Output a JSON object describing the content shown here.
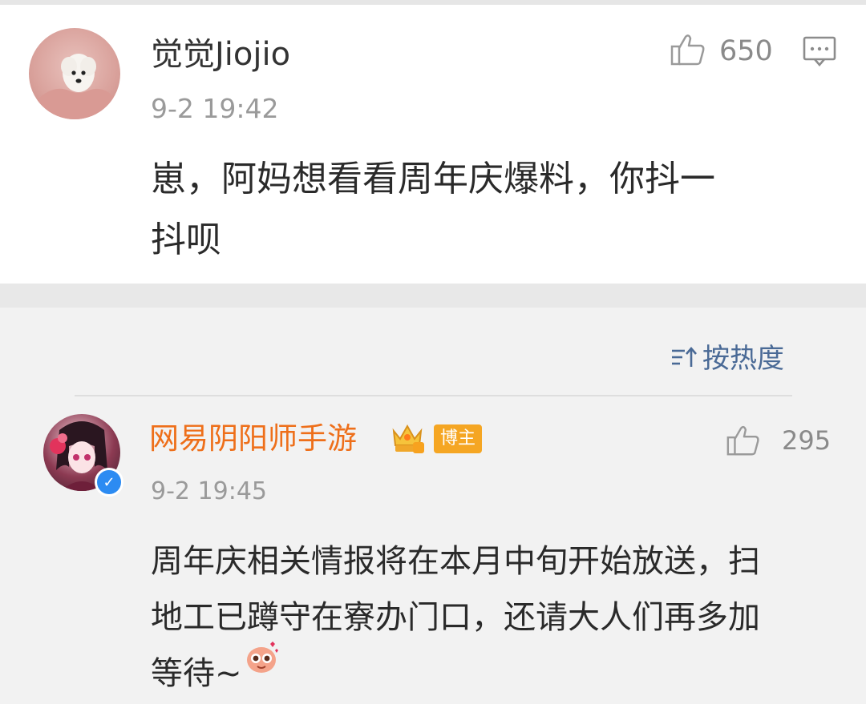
{
  "top_comment": {
    "username": "觉觉Jiojio",
    "time": "9-2 19:42",
    "likes": "650",
    "text": "崽，阿妈想看看周年庆爆料，你抖一\n抖呗"
  },
  "replies": {
    "sort_label": "按热度",
    "items": [
      {
        "username": "网易阴阳师手游",
        "badge": "博主",
        "time": "9-2 19:45",
        "likes": "295",
        "text": "周年庆相关情报将在本月中旬开始放送，扫\n地工已蹲守在寮办门口，还请大人们再多加\n等待~"
      }
    ]
  },
  "colors": {
    "username_default": "#333333",
    "username_official": "#ee6f1a",
    "sort_accent": "#4a6a96",
    "host_badge": "#f5a623",
    "verified": "#2c8bf2"
  },
  "icons": [
    "thumbs-up-icon",
    "comment-icon",
    "sort-icon",
    "crown-icon",
    "verified-icon",
    "emoji-icon"
  ]
}
